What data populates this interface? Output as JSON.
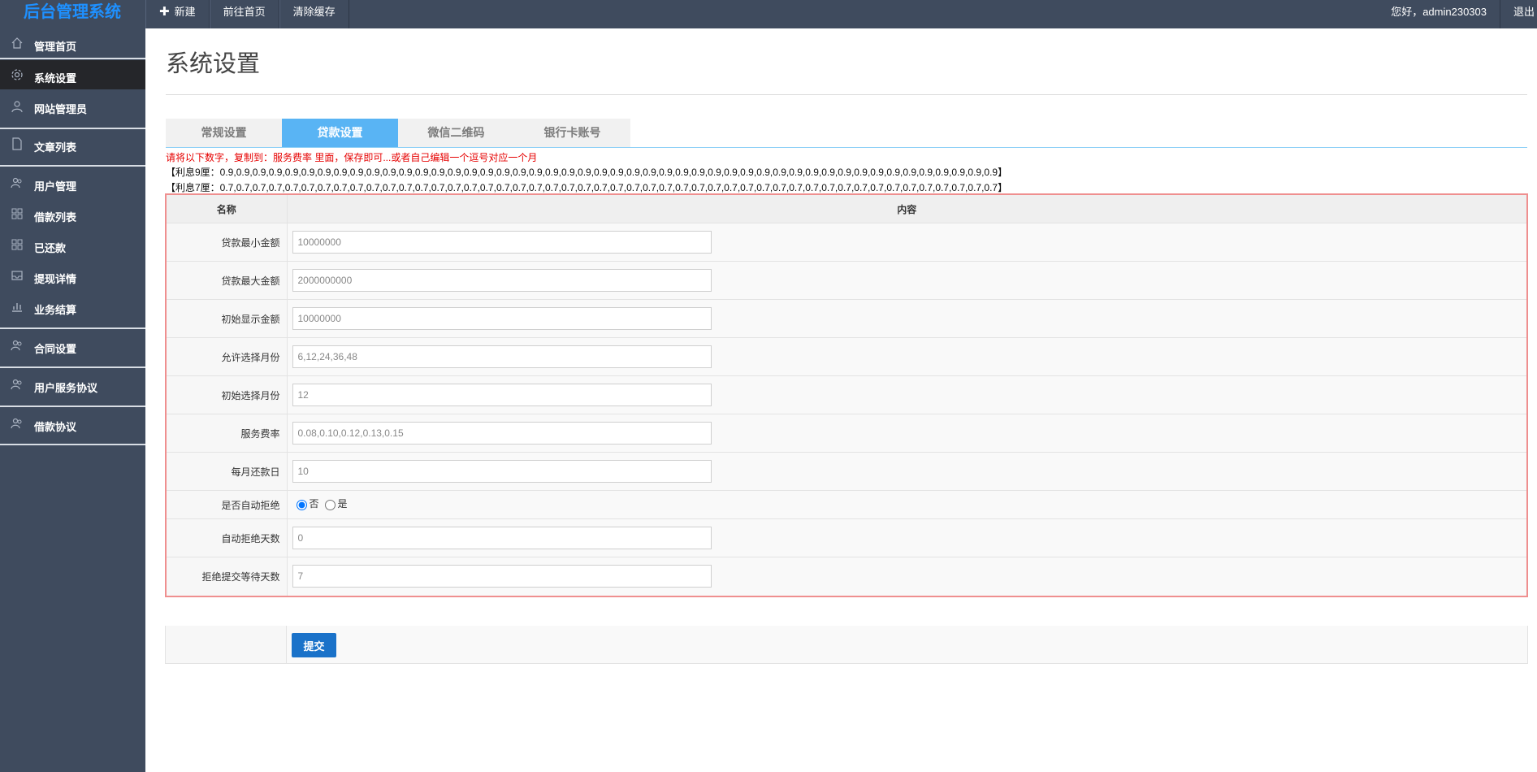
{
  "app": {
    "title": "后台管理系统"
  },
  "topnav": {
    "new_label": "新建",
    "home_label": "前往首页",
    "clear_cache_label": "清除缓存",
    "greeting": "您好，admin230303",
    "logout_label": "退出"
  },
  "sidebar": {
    "items": [
      {
        "label": "管理首页",
        "icon": "home-icon"
      },
      {
        "label": "系统设置",
        "icon": "gear-icon",
        "active": true
      },
      {
        "label": "网站管理员",
        "icon": "user-icon"
      },
      {
        "label": "文章列表",
        "icon": "document-icon"
      },
      {
        "label": "用户管理",
        "icon": "users-icon"
      },
      {
        "label": "借款列表",
        "icon": "grid-icon"
      },
      {
        "label": "已还款",
        "icon": "grid-icon"
      },
      {
        "label": "提现详情",
        "icon": "inbox-icon"
      },
      {
        "label": "业务结算",
        "icon": "chart-icon"
      },
      {
        "label": "合同设置",
        "icon": "users-icon"
      },
      {
        "label": "用户服务协议",
        "icon": "users-icon"
      },
      {
        "label": "借款协议",
        "icon": "users-icon"
      }
    ]
  },
  "page": {
    "title": "系统设置",
    "tabs": [
      "常规设置",
      "贷款设置",
      "微信二维码",
      "银行卡账号"
    ],
    "active_tab": "贷款设置",
    "notice": "请将以下数字，复制到：服务费率 里面，保存即可...或者自己编辑一个逗号对应一个月",
    "rate9": "【利息9厘：0.9,0.9,0.9,0.9,0.9,0.9,0.9,0.9,0.9,0.9,0.9,0.9,0.9,0.9,0.9,0.9,0.9,0.9,0.9,0.9,0.9,0.9,0.9,0.9,0.9,0.9,0.9,0.9,0.9,0.9,0.9,0.9,0.9,0.9,0.9,0.9,0.9,0.9,0.9,0.9,0.9,0.9,0.9,0.9,0.9,0.9,0.9,0.9】",
    "rate7": "【利息7厘：0.7,0.7,0.7,0.7,0.7,0.7,0.7,0.7,0.7,0.7,0.7,0.7,0.7,0.7,0.7,0.7,0.7,0.7,0.7,0.7,0.7,0.7,0.7,0.7,0.7,0.7,0.7,0.7,0.7,0.7,0.7,0.7,0.7,0.7,0.7,0.7,0.7,0.7,0.7,0.7,0.7,0.7,0.7,0.7,0.7,0.7,0.7,0.7】"
  },
  "form": {
    "header_name": "名称",
    "header_content": "内容",
    "min_amount": {
      "label": "贷款最小金额",
      "value": "10000000"
    },
    "max_amount": {
      "label": "贷款最大金额",
      "value": "2000000000"
    },
    "init_amount": {
      "label": "初始显示金额",
      "value": "10000000"
    },
    "months": {
      "label": "允许选择月份",
      "value": "6,12,24,36,48"
    },
    "init_month": {
      "label": "初始选择月份",
      "value": "12"
    },
    "fee_rate": {
      "label": "服务费率",
      "value": "0.08,0.10,0.12,0.13,0.15"
    },
    "repay_day": {
      "label": "每月还款日",
      "value": "10"
    },
    "auto_reject": {
      "label": "是否自动拒绝",
      "option_no": "否",
      "option_yes": "是",
      "selected": "否"
    },
    "reject_days": {
      "label": "自动拒绝天数",
      "value": "0"
    },
    "wait_days": {
      "label": "拒绝提交等待天数",
      "value": "7"
    },
    "submit_label": "提交"
  },
  "colors": {
    "sidebar_bg": "#3f4b5e",
    "brand": "#1e90ff",
    "tab_active": "#59b4f4",
    "submit": "#1a72c9",
    "notice": "#e60000"
  }
}
